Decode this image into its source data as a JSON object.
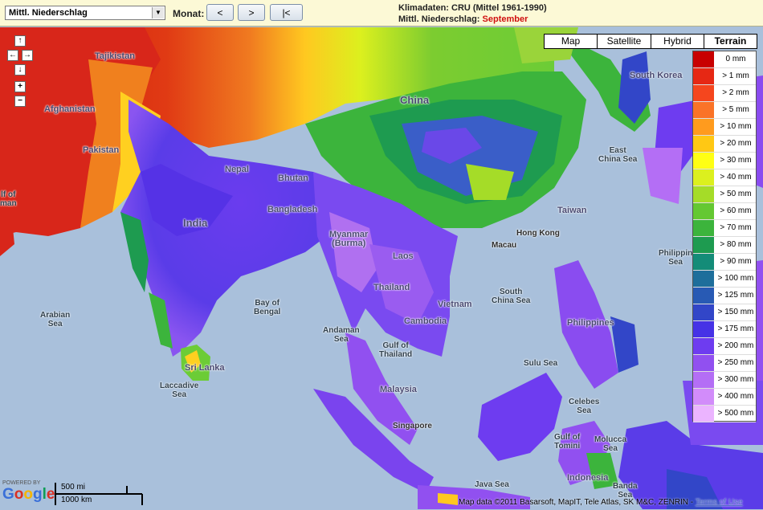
{
  "toolbar": {
    "layer_select": "Mittl. Niederschlag",
    "monat_label": "Monat:",
    "prev_label": "<",
    "next_label": ">",
    "first_label": "|<",
    "info_line1": "Klimadaten: CRU (Mittel 1961-1990)",
    "info_line2_prefix": "Mittl. Niederschlag:",
    "info_month": "September"
  },
  "map_types": [
    "Map",
    "Satellite",
    "Hybrid",
    "Terrain"
  ],
  "active_map_type": "Terrain",
  "nav_controls": {
    "up": "↑",
    "left": "←",
    "right": "→",
    "down": "↓",
    "zoom_in": "+",
    "zoom_out": "−"
  },
  "legend": [
    {
      "label": "0 mm",
      "color": "#c80000"
    },
    {
      "label": "> 1 mm",
      "color": "#e62814"
    },
    {
      "label": "> 2 mm",
      "color": "#f5461e"
    },
    {
      "label": "> 5 mm",
      "color": "#fa7328"
    },
    {
      "label": "> 10 mm",
      "color": "#ff9b1e"
    },
    {
      "label": "> 20 mm",
      "color": "#ffc814"
    },
    {
      "label": "> 30 mm",
      "color": "#ffff14"
    },
    {
      "label": "> 40 mm",
      "color": "#dcf01e"
    },
    {
      "label": "> 50 mm",
      "color": "#a5dc28"
    },
    {
      "label": "> 60 mm",
      "color": "#64c832"
    },
    {
      "label": "> 70 mm",
      "color": "#3cb43c"
    },
    {
      "label": "> 80 mm",
      "color": "#1e9b50"
    },
    {
      "label": "> 90 mm",
      "color": "#148c78"
    },
    {
      "label": "> 100 mm",
      "color": "#1e6e9b"
    },
    {
      "label": "> 125 mm",
      "color": "#285ab4"
    },
    {
      "label": "> 150 mm",
      "color": "#3246c8"
    },
    {
      "label": "> 175 mm",
      "color": "#4632e6"
    },
    {
      "label": "> 200 mm",
      "color": "#6e3cf0"
    },
    {
      "label": "> 250 mm",
      "color": "#9150f0"
    },
    {
      "label": "> 300 mm",
      "color": "#b46ef5"
    },
    {
      "label": "> 400 mm",
      "color": "#d28cfa"
    },
    {
      "label": "> 500 mm",
      "color": "#ebb4ff"
    }
  ],
  "labels": {
    "tajikistan": "Tajikistan",
    "afghanistan": "Afghanistan",
    "pakistan": "Pakistan",
    "gulf_of_oman": "lf of\nman",
    "nepal": "Nepal",
    "bhutan": "Bhutan",
    "bangladesh": "Bangladesh",
    "india": "India",
    "china": "China",
    "south_korea": "South Korea",
    "east_china_sea": "East\nChina Sea",
    "taiwan": "Taiwan",
    "hong_kong": "Hong Kong",
    "macau": "Macau",
    "myanmar": "Myanmar\n(Burma)",
    "laos": "Laos",
    "thailand": "Thailand",
    "vietnam": "Vietnam",
    "cambodia": "Cambodia",
    "south_china_sea": "South\nChina Sea",
    "philippine_sea": "Philippin\nSea",
    "philippines": "Philippines",
    "arabian_sea": "Arabian\nSea",
    "bay_of_bengal": "Bay of\nBengal",
    "andaman_sea": "Andaman\nSea",
    "gulf_of_thailand": "Gulf of\nThailand",
    "sri_lanka": "Sri Lanka",
    "laccadive_sea": "Laccadive\nSea",
    "malaysia": "Malaysia",
    "singapore": "Singapore",
    "sulu_sea": "Sulu Sea",
    "celebes_sea": "Celebes\nSea",
    "gulf_of_tomini": "Gulf of\nTomini",
    "molucca_sea": "Molucca\nSea",
    "indonesia": "Indonesia",
    "java_sea": "Java Sea",
    "banda_sea": "Banda\nSea"
  },
  "footer": {
    "powered_by": "POWERED BY",
    "google": "Google",
    "scale_mi": "500 mi",
    "scale_km": "1000 km",
    "attribution": "Map data ©2011 Basarsoft, MapIT, Tele Atlas, SK M&C, ZENRIN -",
    "terms": "Terms of Use"
  }
}
